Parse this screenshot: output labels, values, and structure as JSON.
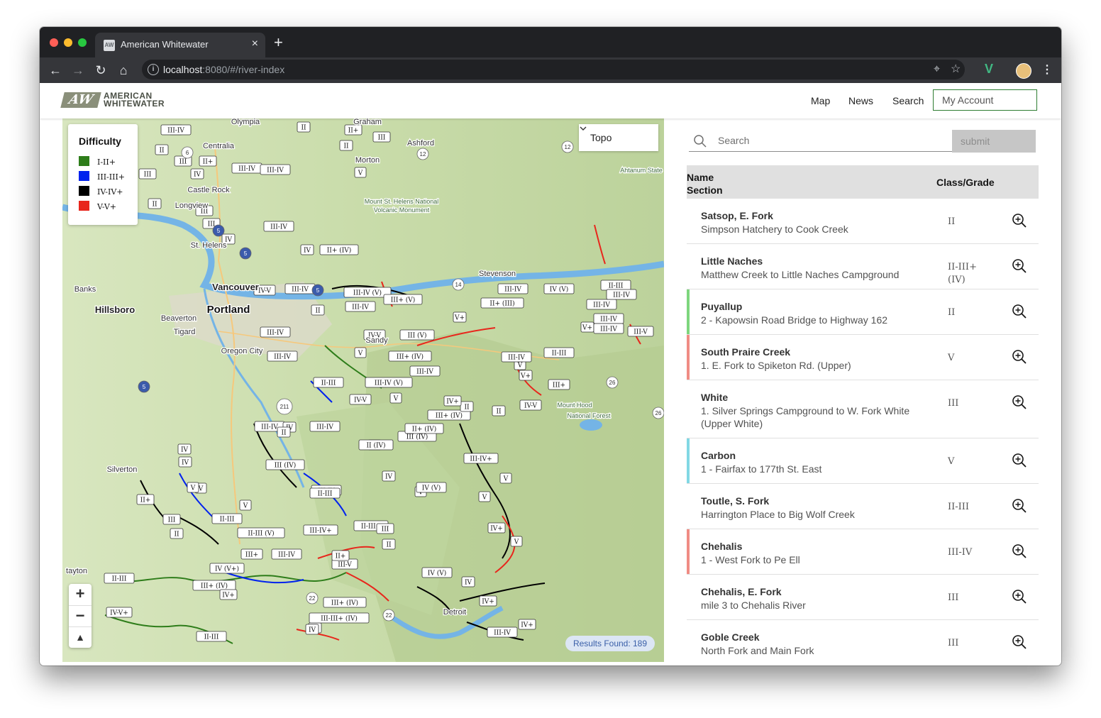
{
  "browser": {
    "tab_title": "American Whitewater",
    "favicon_text": "AW",
    "url_host": "localhost",
    "url_rest": ":8080/#/river-index"
  },
  "header": {
    "logo_mark": "AW",
    "logo_line1": "AMERICAN",
    "logo_line2": "WHITEWATER",
    "nav": [
      "Map",
      "News",
      "Search"
    ],
    "account_label": "My Account"
  },
  "map": {
    "legend_title": "Difficulty",
    "legend": [
      {
        "label": "I-II+",
        "color": "#2e7d1a"
      },
      {
        "label": "III-III+",
        "color": "#0022ee"
      },
      {
        "label": "IV-IV+",
        "color": "#000000"
      },
      {
        "label": "V-V+",
        "color": "#e8261c"
      }
    ],
    "basemap_label": "Topo",
    "results_label": "Results Found: 189",
    "places": [
      {
        "name": "Olympia",
        "cls": "town"
      },
      {
        "name": "Graham",
        "cls": "town"
      },
      {
        "name": "Ashford",
        "cls": "town"
      },
      {
        "name": "Centralia",
        "cls": "town"
      },
      {
        "name": "Morton",
        "cls": "town"
      },
      {
        "name": "Castle Rock",
        "cls": "town"
      },
      {
        "name": "Longview",
        "cls": "town"
      },
      {
        "name": "Mount St. Helens National",
        "cls": "park"
      },
      {
        "name": "Volcanic Monument",
        "cls": "park"
      },
      {
        "name": "Ahtanum State",
        "cls": "park"
      },
      {
        "name": "St. Helens",
        "cls": "town"
      },
      {
        "name": "Stevenson",
        "cls": "town"
      },
      {
        "name": "Banks",
        "cls": "town"
      },
      {
        "name": "Vancouver",
        "cls": "city"
      },
      {
        "name": "Hillsboro",
        "cls": "city"
      },
      {
        "name": "Portland",
        "cls": "bigcity"
      },
      {
        "name": "Beaverton",
        "cls": "town"
      },
      {
        "name": "Tigard",
        "cls": "town"
      },
      {
        "name": "Oregon City",
        "cls": "town"
      },
      {
        "name": "Sandy",
        "cls": "town"
      },
      {
        "name": "Mount Hood",
        "cls": "park"
      },
      {
        "name": "National Forest",
        "cls": "park"
      },
      {
        "name": "Silverton",
        "cls": "town"
      },
      {
        "name": "tayton",
        "cls": "town"
      },
      {
        "name": "Detroit",
        "cls": "town"
      }
    ],
    "shields": [
      "5",
      "5",
      "5",
      "5",
      "12",
      "12",
      "6",
      "14",
      "211",
      "26",
      "26",
      "22",
      "22"
    ],
    "grades": [
      "II",
      "II",
      "II+",
      "III",
      "II",
      "II",
      "III",
      "II+",
      "III-IV",
      "III-IV",
      "V",
      "III",
      "IV",
      "II",
      "II-III",
      "III",
      "III",
      "IV",
      "III-IV",
      "IV",
      "II+ (IV)",
      "IV-V",
      "III-IV",
      "III-IV (V)",
      "III+ (V)",
      "V+",
      "III-IV",
      "II+ (III)",
      "IV (V)",
      "II-III",
      "III-IV",
      "III-V",
      "III-IV",
      "II",
      "IV-V",
      "III (V)",
      "V",
      "III-IV",
      "III-IV",
      "II-III",
      "V+",
      "II-III",
      "V",
      "III+ (IV)",
      "III+ (IV)",
      "III-IV (V)",
      "IV-V",
      "III-IV",
      "II",
      "II",
      "II",
      "V",
      "III-IV",
      "IV",
      "V",
      "IV+",
      "III-IV+",
      "II-III+",
      "V",
      "III-V",
      "IV (V)",
      "V",
      "IV",
      "IV+",
      "IV+",
      "III-IV",
      "II",
      "IV (V+)",
      "II-III",
      "IV-V+",
      "III+ (IV)",
      "III+ (IV)",
      "III",
      "IV",
      "III-IV",
      "III (IV)",
      "II+ (IV)",
      "II (IV)",
      "III-IV",
      "III-IV",
      "IV",
      "V",
      "II-III",
      "V",
      "III+",
      "III-IV",
      "II+",
      "IV+",
      "III (IV)",
      "II-III",
      "II-III (V)",
      "III-IV+",
      "II+",
      "III",
      "V",
      "II",
      "IV",
      "II",
      "III-IV",
      "III+",
      "IV-V",
      "V+",
      "III-IV",
      "IV (V)",
      "II",
      "III-III+ (IV)",
      "V",
      "III-IV",
      "IV+",
      "IV",
      "II-III",
      "III-IV"
    ]
  },
  "search": {
    "placeholder": "Search",
    "submit_label": "submit"
  },
  "table": {
    "col_name": "Name",
    "col_section": "Section",
    "col_class": "Class/Grade",
    "rows": [
      {
        "name": "Satsop, E. Fork",
        "section": "Simpson Hatchery to Cook Creek",
        "grade": "II",
        "bar": ""
      },
      {
        "name": "Little Naches",
        "section": "Matthew Creek to Little Naches Campground",
        "grade": "II-III+ (IV)",
        "bar": ""
      },
      {
        "name": "Puyallup",
        "section": "2 - Kapowsin Road Bridge to Highway 162",
        "grade": "II",
        "bar": "#7ed67e"
      },
      {
        "name": "South Praire Creek",
        "section": "1. E. Fork to Spiketon Rd. (Upper)",
        "grade": "V",
        "bar": "#f08c84"
      },
      {
        "name": "White",
        "section": "1. Silver Springs Campground to W. Fork White (Upper White)",
        "grade": "III",
        "bar": ""
      },
      {
        "name": "Carbon",
        "section": "1 - Fairfax to 177th St. East",
        "grade": "V",
        "bar": "#82d8e4"
      },
      {
        "name": "Toutle, S. Fork",
        "section": "Harrington Place to Big Wolf Creek",
        "grade": "II-III",
        "bar": ""
      },
      {
        "name": "Chehalis",
        "section": "1 - West Fork to Pe Ell",
        "grade": "III-IV",
        "bar": "#f08c84"
      },
      {
        "name": "Chehalis, E. Fork",
        "section": "mile 3 to Chehalis River",
        "grade": "III",
        "bar": ""
      },
      {
        "name": "Goble Creek",
        "section": "North Fork and Main Fork",
        "grade": "III",
        "bar": ""
      }
    ]
  }
}
